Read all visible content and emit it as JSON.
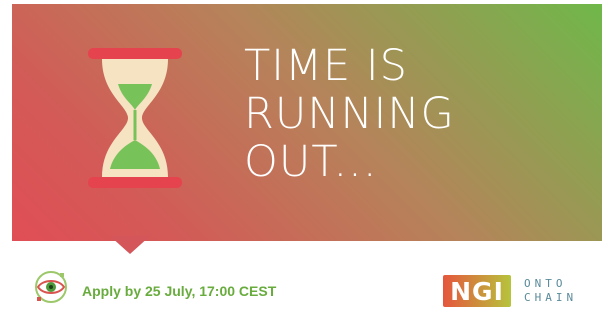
{
  "banner": {
    "headline_line1": "TIME IS",
    "headline_line2": "RUNNING",
    "headline_line3": "OUT...",
    "hourglass_icon": "hourglass-icon",
    "gradient_colors": [
      "#6fb84a",
      "#b5845a",
      "#e04e55"
    ]
  },
  "footer": {
    "apply_text": "Apply by 25 July, 17:00 CEST",
    "apply_color": "#69ac3e",
    "left_logo_icon": "eye-logo-icon",
    "ngi_label": "NGI",
    "onto_label": "ONTO",
    "chain_label": "CHAIN"
  }
}
